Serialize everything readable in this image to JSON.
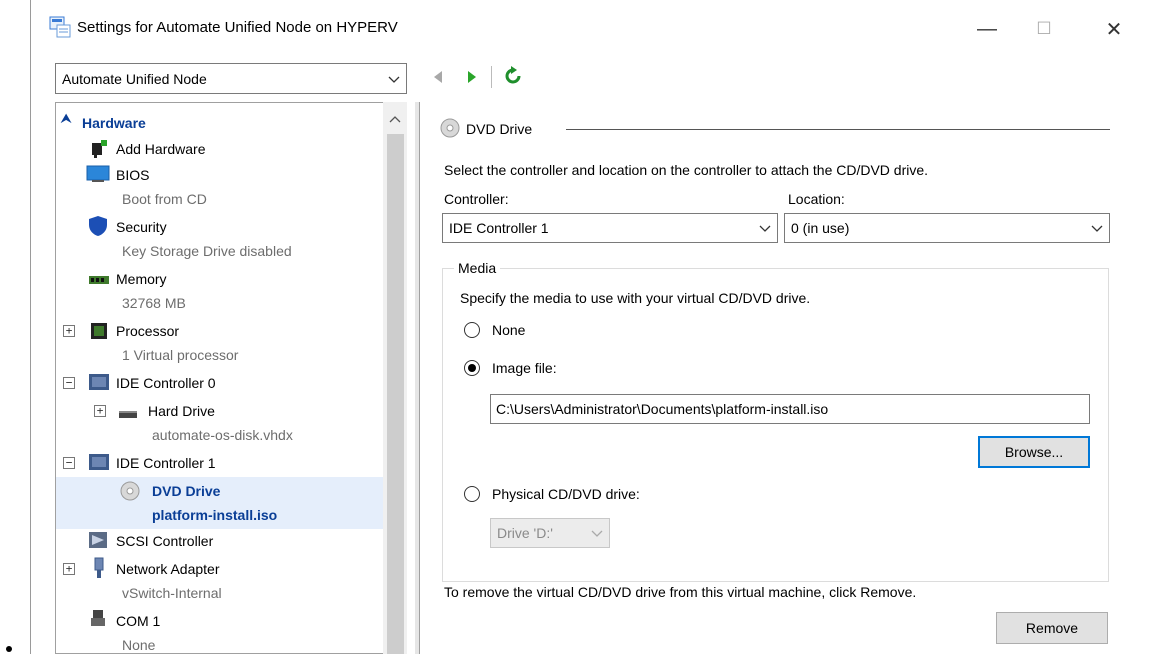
{
  "window": {
    "title": "Settings for Automate Unified Node on HYPERV",
    "minimize_glyph": "—",
    "maximize_glyph": "☐",
    "close_glyph": "✕"
  },
  "vm_selector": {
    "value": "Automate Unified Node"
  },
  "nav": {
    "back_icon": "back-arrow-icon",
    "forward_icon": "forward-arrow-icon",
    "refresh_icon": "refresh-icon"
  },
  "tree": {
    "section_header": "Hardware",
    "items": [
      {
        "label": "Add Hardware",
        "sub": ""
      },
      {
        "label": "BIOS",
        "sub": "Boot from CD"
      },
      {
        "label": "Security",
        "sub": "Key Storage Drive disabled"
      },
      {
        "label": "Memory",
        "sub": "32768 MB"
      },
      {
        "label": "Processor",
        "sub": "1 Virtual processor"
      },
      {
        "label": "IDE Controller 0",
        "sub": ""
      },
      {
        "label": "Hard Drive",
        "sub": "automate-os-disk.vhdx"
      },
      {
        "label": "IDE Controller 1",
        "sub": ""
      },
      {
        "label": "DVD Drive",
        "sub": "platform-install.iso"
      },
      {
        "label": "SCSI Controller",
        "sub": ""
      },
      {
        "label": "Network Adapter",
        "sub": "vSwitch-Internal"
      },
      {
        "label": "COM 1",
        "sub": "None"
      }
    ]
  },
  "dvd": {
    "heading": "DVD Drive",
    "instruction": "Select the controller and location on the controller to attach the CD/DVD drive.",
    "controller_label": "Controller:",
    "controller_value": "IDE Controller 1",
    "location_label": "Location:",
    "location_value": "0 (in use)",
    "media": {
      "legend": "Media",
      "instruction": "Specify the media to use with your virtual CD/DVD drive.",
      "none_label": "None",
      "image_label": "Image file:",
      "image_path": "C:\\Users\\Administrator\\Documents\\platform-install.iso",
      "browse_label": "Browse...",
      "physical_label": "Physical CD/DVD drive:",
      "physical_drive_value": "Drive 'D:'",
      "selected": "image"
    },
    "remove_instruction": "To remove the virtual CD/DVD drive from this virtual machine, click Remove.",
    "remove_label": "Remove"
  },
  "colors": {
    "accent": "#0078d7",
    "selection": "#e5eefb",
    "header_text": "#0a3e96"
  }
}
